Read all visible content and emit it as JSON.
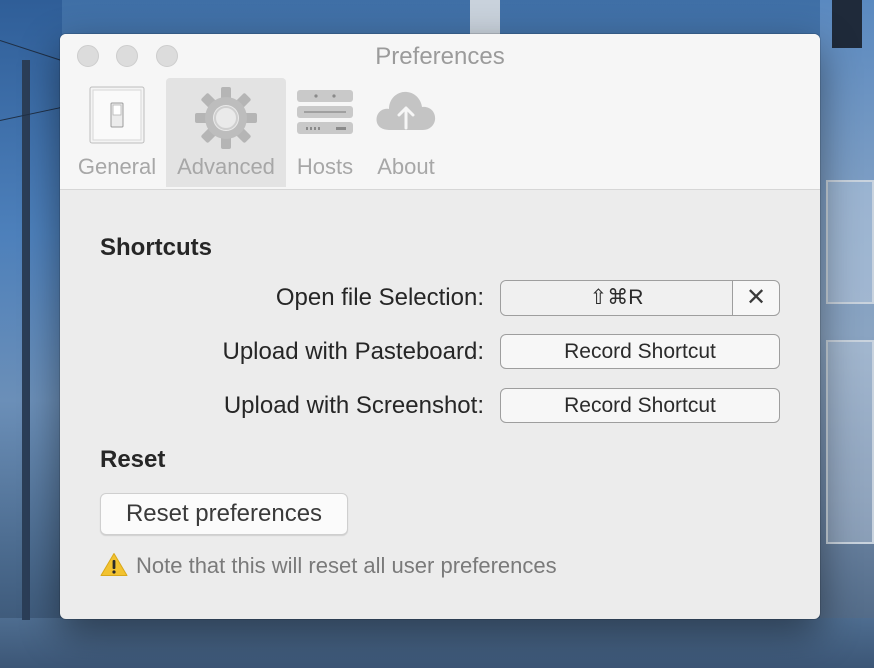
{
  "window": {
    "title": "Preferences"
  },
  "tabs": [
    {
      "label": "General",
      "icon": "light-switch-icon",
      "selected": false
    },
    {
      "label": "Advanced",
      "icon": "gear-icon",
      "selected": true
    },
    {
      "label": "Hosts",
      "icon": "server-icon",
      "selected": false
    },
    {
      "label": "About",
      "icon": "cloud-upload-icon",
      "selected": false
    }
  ],
  "shortcuts": {
    "heading": "Shortcuts",
    "rows": [
      {
        "label": "Open file Selection:",
        "value": "⇧⌘R",
        "clear": "✕"
      },
      {
        "label": "Upload with Pasteboard:",
        "button": "Record Shortcut"
      },
      {
        "label": "Upload with Screenshot:",
        "button": "Record Shortcut"
      }
    ]
  },
  "reset": {
    "heading": "Reset",
    "button": "Reset preferences",
    "note": "Note that this will reset all user preferences"
  },
  "colors": {
    "window_bg": "#ececec",
    "toolbar_bg": "#f6f6f6",
    "warning": "#f2c230"
  }
}
